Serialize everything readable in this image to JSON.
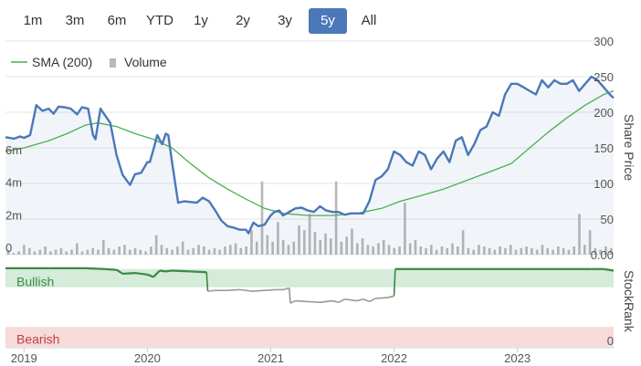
{
  "range_selector": {
    "buttons": [
      {
        "label": "1m",
        "active": false
      },
      {
        "label": "3m",
        "active": false
      },
      {
        "label": "6m",
        "active": false
      },
      {
        "label": "YTD",
        "active": false
      },
      {
        "label": "1y",
        "active": false
      },
      {
        "label": "2y",
        "active": false
      },
      {
        "label": "3y",
        "active": false
      },
      {
        "label": "5y",
        "active": true
      },
      {
        "label": "All",
        "active": false
      }
    ]
  },
  "legend": {
    "sma_label": "SMA (200)",
    "volume_label": "Volume"
  },
  "colors": {
    "price": "#4a78b8",
    "sma": "#4caf50",
    "volume": "#b8b8b8",
    "bullish_zone": "#d4ecd9",
    "bearish_zone": "#f7dada",
    "bullish_text": "#3a8a45",
    "bearish_text": "#c0404a",
    "stockrank_bull": "#3a8a45",
    "stockrank_bear": "#999999",
    "active_button": "#4a78b8"
  },
  "chart_data": [
    {
      "type": "line",
      "title": "",
      "ylabel_right": "Share Price",
      "right_ticks": [
        "0.00",
        "50",
        "100",
        "150",
        "200",
        "250",
        "300"
      ],
      "left_ticks": [
        "0",
        "2m",
        "4m",
        "6m"
      ],
      "x_ticks": [
        "2019",
        "2020",
        "2021",
        "2022",
        "2023"
      ],
      "ylim": [
        0,
        300
      ],
      "x_range": [
        2018.85,
        2023.78
      ],
      "series": [
        {
          "name": "Price",
          "x": [
            2018.85,
            2018.92,
            2018.97,
            2019.0,
            2019.05,
            2019.1,
            2019.15,
            2019.2,
            2019.24,
            2019.28,
            2019.33,
            2019.38,
            2019.43,
            2019.47,
            2019.52,
            2019.56,
            2019.58,
            2019.62,
            2019.66,
            2019.7,
            2019.75,
            2019.8,
            2019.86,
            2019.9,
            2019.95,
            2020.0,
            2020.02,
            2020.05,
            2020.08,
            2020.12,
            2020.15,
            2020.17,
            2020.2,
            2020.25,
            2020.3,
            2020.35,
            2020.4,
            2020.45,
            2020.5,
            2020.55,
            2020.6,
            2020.65,
            2020.7,
            2020.75,
            2020.8,
            2020.82,
            2020.86,
            2020.9,
            2020.95,
            2021.0,
            2021.03,
            2021.07,
            2021.1,
            2021.15,
            2021.2,
            2021.25,
            2021.3,
            2021.35,
            2021.4,
            2021.45,
            2021.5,
            2021.55,
            2021.6,
            2021.65,
            2021.7,
            2021.75,
            2021.8,
            2021.85,
            2021.9,
            2021.95,
            2022.0,
            2022.05,
            2022.1,
            2022.15,
            2022.2,
            2022.25,
            2022.3,
            2022.35,
            2022.4,
            2022.45,
            2022.5,
            2022.55,
            2022.6,
            2022.65,
            2022.7,
            2022.75,
            2022.8,
            2022.85,
            2022.9,
            2022.95,
            2023.0,
            2023.05,
            2023.1,
            2023.15,
            2023.2,
            2023.25,
            2023.3,
            2023.35,
            2023.4,
            2023.45,
            2023.5,
            2023.55,
            2023.6,
            2023.65,
            2023.7,
            2023.75,
            2023.78
          ],
          "y": [
            165,
            163,
            166,
            164,
            168,
            210,
            202,
            205,
            198,
            208,
            207,
            205,
            197,
            207,
            205,
            168,
            162,
            205,
            195,
            185,
            140,
            112,
            98,
            113,
            115,
            130,
            130,
            148,
            168,
            155,
            170,
            168,
            130,
            73,
            75,
            74,
            73,
            80,
            75,
            62,
            48,
            40,
            38,
            35,
            35,
            30,
            45,
            40,
            42,
            55,
            60,
            62,
            55,
            60,
            65,
            66,
            62,
            60,
            68,
            62,
            60,
            60,
            56,
            58,
            58,
            58,
            75,
            105,
            110,
            120,
            145,
            140,
            130,
            125,
            145,
            140,
            120,
            135,
            145,
            130,
            160,
            165,
            140,
            155,
            175,
            180,
            200,
            195,
            225,
            240,
            240,
            235,
            230,
            225,
            245,
            235,
            245,
            240,
            240,
            245,
            230,
            240,
            250,
            245,
            235,
            225,
            220
          ]
        },
        {
          "name": "SMA (200)",
          "x": [
            2018.85,
            2019.0,
            2019.2,
            2019.35,
            2019.5,
            2019.6,
            2019.75,
            2019.9,
            2020.05,
            2020.2,
            2020.35,
            2020.5,
            2020.65,
            2020.8,
            2020.95,
            2021.1,
            2021.3,
            2021.5,
            2021.7,
            2021.9,
            2022.05,
            2022.2,
            2022.4,
            2022.6,
            2022.8,
            2022.95,
            2023.1,
            2023.25,
            2023.4,
            2023.55,
            2023.7,
            2023.78
          ],
          "y": [
            145,
            150,
            160,
            170,
            182,
            185,
            180,
            170,
            162,
            150,
            128,
            108,
            92,
            78,
            65,
            58,
            55,
            55,
            58,
            65,
            75,
            82,
            92,
            105,
            118,
            128,
            150,
            172,
            192,
            210,
            225,
            230
          ]
        }
      ],
      "volume_bars_m": [
        0.3,
        0.1,
        0.2,
        0.6,
        0.4,
        0.2,
        0.3,
        0.5,
        0.2,
        0.3,
        0.4,
        0.2,
        0.3,
        0.7,
        0.2,
        0.3,
        0.4,
        0.3,
        0.9,
        0.4,
        0.3,
        0.5,
        0.6,
        0.3,
        0.4,
        0.3,
        0.2,
        0.5,
        1.2,
        0.6,
        0.4,
        0.3,
        0.5,
        0.8,
        0.3,
        0.4,
        0.6,
        0.5,
        0.3,
        0.4,
        0.3,
        0.5,
        0.6,
        0.7,
        0.4,
        0.5,
        1.5,
        0.8,
        4.5,
        1.2,
        0.8,
        2.0,
        0.9,
        0.6,
        0.8,
        1.8,
        1.5,
        2.5,
        1.4,
        0.9,
        1.3,
        1.0,
        4.5,
        0.8,
        1.1,
        1.6,
        0.7,
        1.0,
        0.6,
        0.5,
        0.7,
        0.9,
        0.6,
        0.4,
        0.5,
        3.2,
        0.7,
        0.9,
        0.5,
        0.4,
        0.6,
        0.3,
        0.5,
        0.4,
        0.7,
        0.5,
        1.5,
        0.4,
        0.3,
        0.6,
        0.5,
        0.4,
        0.3,
        0.5,
        0.4,
        0.6,
        0.3,
        0.4,
        0.5,
        0.4,
        0.3,
        0.6,
        0.4,
        0.3,
        0.5,
        0.4,
        0.3,
        0.5,
        2.5,
        0.6,
        1.5,
        0.4,
        0.3,
        0.5,
        0.4
      ]
    },
    {
      "type": "line",
      "title": "",
      "ylabel_right": "StockRank",
      "zones": [
        "Bullish",
        "Bearish"
      ],
      "right_ticks": [
        "0"
      ],
      "x": [
        2018.85,
        2019.2,
        2019.5,
        2019.65,
        2019.75,
        2019.8,
        2019.9,
        2019.95,
        2020.0,
        2020.05,
        2020.1,
        2020.15,
        2020.2,
        2020.35,
        2020.48,
        2020.49,
        2020.55,
        2020.65,
        2020.75,
        2020.85,
        2020.95,
        2021.05,
        2021.1,
        2021.15,
        2021.16,
        2021.2,
        2021.3,
        2021.4,
        2021.5,
        2021.55,
        2021.6,
        2021.7,
        2021.75,
        2021.8,
        2021.85,
        2021.95,
        2022.0,
        2022.01,
        2022.2,
        2022.5,
        2022.8,
        2023.0,
        2023.2,
        2023.4,
        2023.6,
        2023.7,
        2023.78
      ],
      "y": [
        99,
        99,
        99,
        98,
        97,
        92,
        93,
        92,
        91,
        88,
        96,
        95,
        96,
        95,
        94,
        70,
        71,
        71,
        72,
        70,
        71,
        72,
        72,
        74,
        55,
        58,
        57,
        56,
        58,
        56,
        60,
        58,
        60,
        57,
        61,
        62,
        64,
        98,
        98,
        98,
        98,
        98,
        98,
        98,
        98,
        98,
        96
      ]
    }
  ]
}
